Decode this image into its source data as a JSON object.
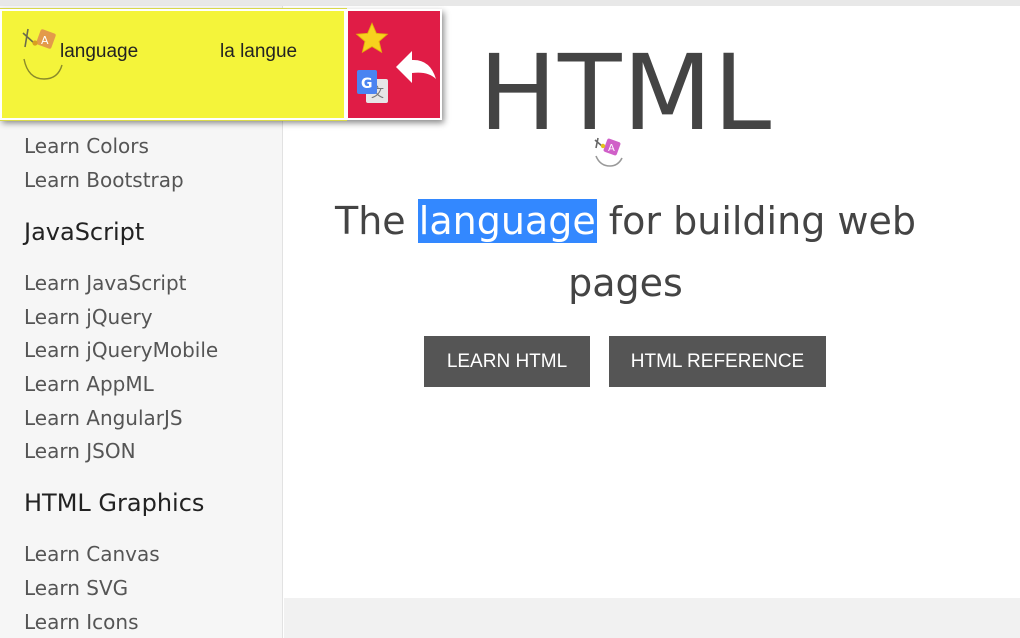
{
  "sidebar": {
    "links_top": [
      "Learn Colors",
      "Learn Bootstrap"
    ],
    "heading_js": "JavaScript",
    "links_js": [
      "Learn JavaScript",
      "Learn jQuery",
      "Learn jQueryMobile",
      "Learn AppML",
      "Learn AngularJS",
      "Learn JSON"
    ],
    "heading_graphics": "HTML Graphics",
    "links_graphics": [
      "Learn Canvas",
      "Learn SVG",
      "Learn Icons"
    ]
  },
  "hero": {
    "title": "HTML",
    "sub_before": "The ",
    "sub_highlight": "language",
    "sub_after": " for building web pages",
    "learn_button": "LEARN HTML",
    "reference_button": "HTML REFERENCE"
  },
  "popup": {
    "source_word": "language",
    "translated_word": "la langue",
    "icons": {
      "logo": "translator-logo-icon",
      "star": "star-icon",
      "google_translate": "google-translate-icon",
      "back": "back-arrow-icon"
    }
  },
  "colors": {
    "highlight": "#3388ff",
    "popup_yellow": "#f4f43a",
    "popup_red": "#e01c46",
    "button": "#555555"
  }
}
